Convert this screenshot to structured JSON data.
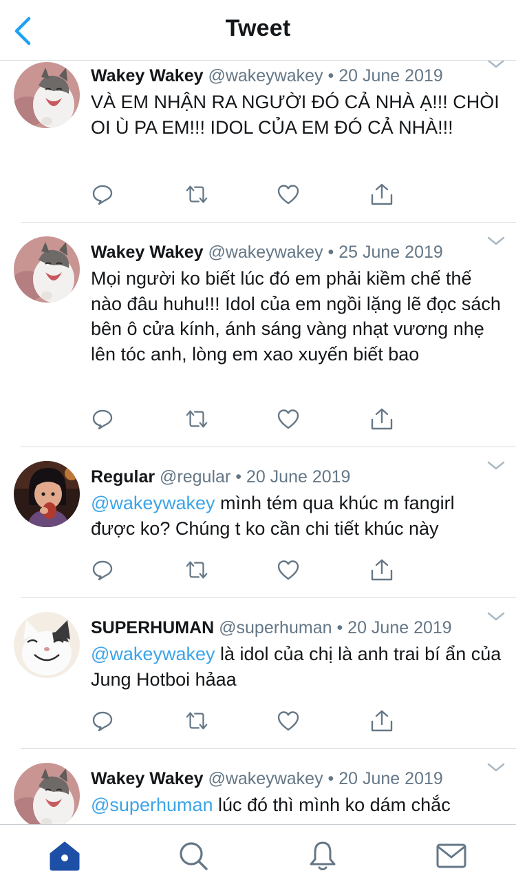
{
  "header": {
    "title": "Tweet",
    "back_icon": "chevron-left-icon"
  },
  "colors": {
    "accent": "#1da1f2",
    "mention": "#3ba4e8",
    "muted": "#657786",
    "icon": "#657786"
  },
  "tweets": [
    {
      "name": "Wakey Wakey",
      "handle": "@wakeywakey",
      "date": "20 June 2019",
      "mention": "",
      "text": "VÀ EM NHẬN RA NGƯỜI ĐÓ CẢ NHÀ Ạ!!! CHÒI OI Ù PA EM!!! IDOL CỦA EM ĐÓ CẢ NHÀ!!!"
    },
    {
      "name": "Wakey Wakey",
      "handle": "@wakeywakey",
      "date": "25 June 2019",
      "mention": "",
      "text": "Mọi người ko biết lúc đó em phải kiềm chế thế nào đâu huhu!!! Idol của em ngồi lặng lẽ đọc sách bên ô cửa kính, ánh sáng vàng nhạt vương nhẹ lên tóc anh, lòng em xao xuyến biết bao"
    },
    {
      "name": "Regular",
      "handle": "@regular",
      "date": "20 June 2019",
      "mention": "@wakeywakey",
      "text": " mình tém qua khúc m fangirl được ko? Chúng t ko cần chi tiết khúc này"
    },
    {
      "name": "SUPERHUMAN",
      "handle": "@superhuman",
      "date": "20 June 2019",
      "mention": "@wakeywakey",
      "text": " là idol của chị là anh trai bí ẩn của Jung Hotboi hảaa"
    },
    {
      "name": "Wakey Wakey",
      "handle": "@wakeywakey",
      "date": "20 June 2019",
      "mention": "@superhuman",
      "text": " lúc đó thì mình ko dám chắc"
    }
  ],
  "meta_separator": "•",
  "tweet_actions": [
    "reply-icon",
    "retweet-icon",
    "like-icon",
    "share-icon"
  ],
  "tabbar": {
    "items": [
      "home-icon",
      "search-icon",
      "notifications-icon",
      "messages-icon"
    ],
    "active": "home-icon"
  }
}
